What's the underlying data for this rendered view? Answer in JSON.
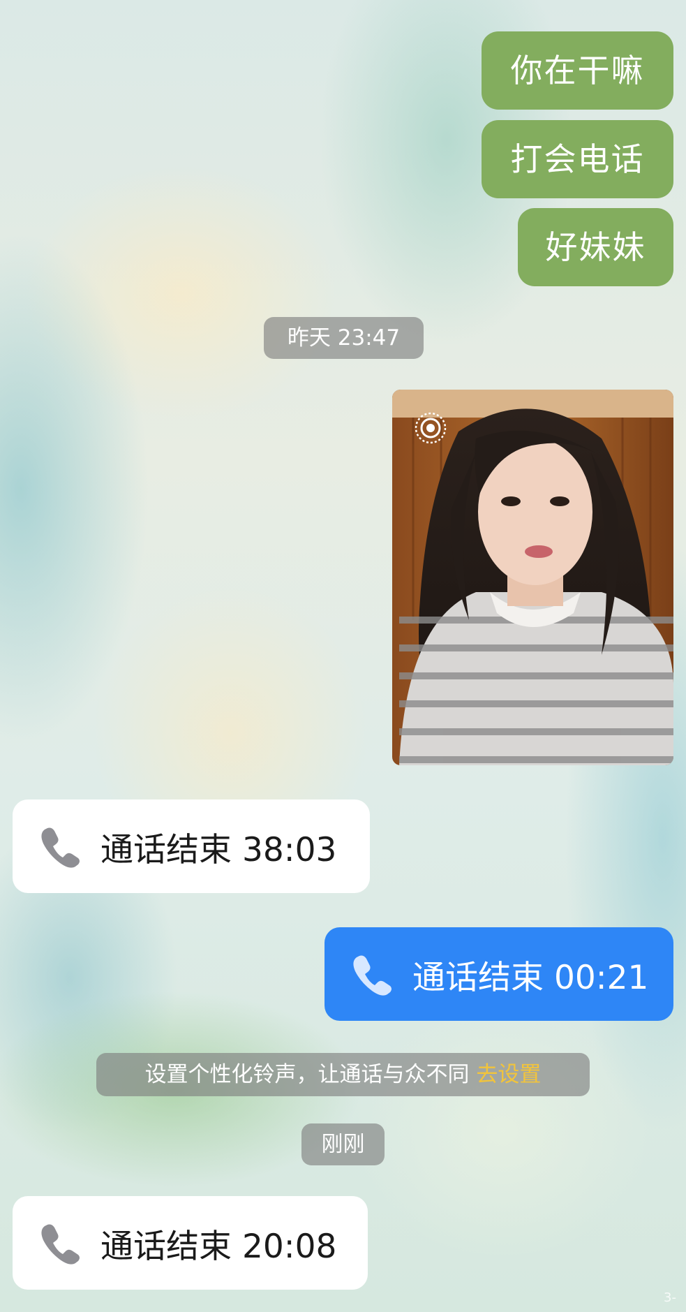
{
  "messages_out": [
    {
      "text": "你在干嘛"
    },
    {
      "text": "打会电话"
    },
    {
      "text": "好妹妹"
    }
  ],
  "timestamps": {
    "yesterday": "昨天 23:47",
    "just_now": "刚刚"
  },
  "photo": {
    "live_icon": "live-photo-icon",
    "subject": "selfie-photo"
  },
  "calls": [
    {
      "direction": "incoming",
      "text": "通话结束 38:03",
      "icon": "phone-icon"
    },
    {
      "direction": "outgoing",
      "text": "通话结束 00:21",
      "icon": "phone-icon"
    },
    {
      "direction": "incoming",
      "text": "通话结束 20:08",
      "icon": "phone-icon"
    }
  ],
  "ringtone_tip": {
    "text": "设置个性化铃声，让通话与众不同",
    "link": "去设置"
  },
  "watermark": "3-",
  "colors": {
    "outgoing_bubble": "#83ad5e",
    "outgoing_call": "#2e86f6",
    "incoming_call": "#ffffff",
    "tip_link": "#f2c43b",
    "system_pill": "#7d7d7d"
  }
}
